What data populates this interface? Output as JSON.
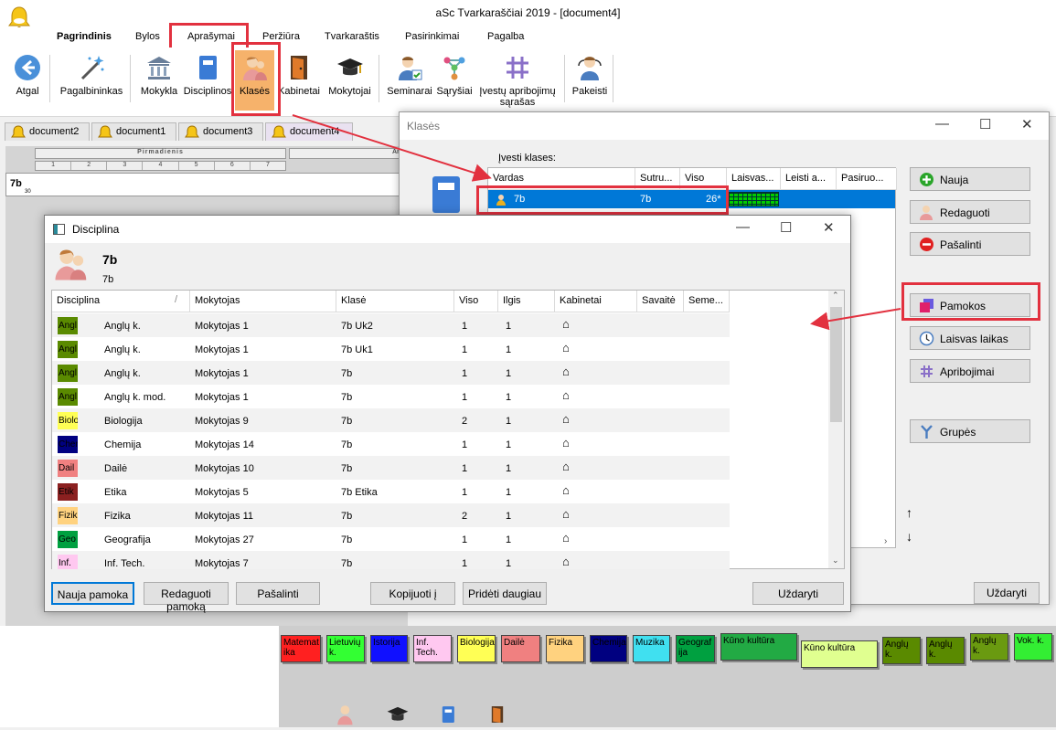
{
  "app": {
    "title": "aSc Tvarkaraščiai 2019  - [document4]"
  },
  "menu": [
    "Pagrindinis",
    "Bylos",
    "Aprašymai",
    "Peržiūra",
    "Tvarkaraštis",
    "Pasirinkimai",
    "Pagalba"
  ],
  "ribbon": {
    "atgal": "Atgal",
    "pagalbininkas": "Pagalbininkas",
    "mokykla": "Mokykla",
    "disciplinos": "Disciplinos",
    "klases": "Klasės",
    "kabinetai": "Kabinetai",
    "mokytojai": "Mokytojai",
    "seminarai": "Seminarai",
    "sarysiai": "Sąryšiai",
    "apribojimai1": "Įvestų apribojimų",
    "apribojimai2": "sąrašas",
    "pakeisti": "Pakeisti"
  },
  "doctabs": [
    "document2",
    "document1",
    "document3",
    "document4"
  ],
  "timetable": {
    "day": "Pirmadienis",
    "day2": "Ar",
    "periods": [
      "1",
      "2",
      "3",
      "4",
      "5",
      "6",
      "7"
    ],
    "row_label": "7b",
    "row_sub": "30"
  },
  "klases": {
    "title": "Klasės",
    "prompt": "Įvesti klases:",
    "columns": [
      "Vardas",
      "Sutru...",
      "Viso",
      "Laisvas...",
      "Leisti a...",
      "Pasiruo..."
    ],
    "row": {
      "name": "7b",
      "short": "7b",
      "total": "26*"
    },
    "buttons": {
      "nauja": "Nauja",
      "redaguoti": "Redaguoti",
      "pasalinti": "Pašalinti",
      "pamokos": "Pamokos",
      "laisvas": "Laisvas laikas",
      "apribojimai": "Apribojimai",
      "grupes": "Grupės",
      "uzdaryti": "Uždaryti"
    }
  },
  "disc": {
    "title": "Disciplina",
    "class_name": "7b",
    "class_short": "7b",
    "columns": [
      "Disciplina",
      "Mokytojas",
      "Klasė",
      "Viso",
      "Ilgis",
      "Kabinetai",
      "Savaitė",
      "Seme..."
    ],
    "rows": [
      {
        "sw": "Angl",
        "swc": "#5a8a00",
        "swt": "#000",
        "disc": "Anglų k.",
        "teacher": "Mokytojas 1",
        "klase": "7b Uk2",
        "viso": "1",
        "ilgis": "1"
      },
      {
        "sw": "Angl",
        "swc": "#5a8a00",
        "swt": "#000",
        "disc": "Anglų k.",
        "teacher": "Mokytojas 1",
        "klase": "7b Uk1",
        "viso": "1",
        "ilgis": "1"
      },
      {
        "sw": "Angl",
        "swc": "#5a8a00",
        "swt": "#000",
        "disc": "Anglų k.",
        "teacher": "Mokytojas 1",
        "klase": "7b",
        "viso": "1",
        "ilgis": "1"
      },
      {
        "sw": "Angl",
        "swc": "#5a8a00",
        "swt": "#000",
        "disc": "Anglų k. mod.",
        "teacher": "Mokytojas 1",
        "klase": "7b",
        "viso": "1",
        "ilgis": "1"
      },
      {
        "sw": "Biolo",
        "swc": "#ffff55",
        "swt": "#000",
        "disc": "Biologija",
        "teacher": "Mokytojas 9",
        "klase": "7b",
        "viso": "2",
        "ilgis": "1"
      },
      {
        "sw": "Chem",
        "swc": "#000080",
        "swt": "#000",
        "disc": "Chemija",
        "teacher": "Mokytojas 14",
        "klase": "7b",
        "viso": "1",
        "ilgis": "1"
      },
      {
        "sw": "Dail",
        "swc": "#f08080",
        "swt": "#000",
        "disc": "Dailė",
        "teacher": "Mokytojas 10",
        "klase": "7b",
        "viso": "1",
        "ilgis": "1"
      },
      {
        "sw": "Etik",
        "swc": "#8b2020",
        "swt": "#000",
        "disc": "Etika",
        "teacher": "Mokytojas 5",
        "klase": "7b Etika",
        "viso": "1",
        "ilgis": "1"
      },
      {
        "sw": "Fizik",
        "swc": "#ffd27f",
        "swt": "#000",
        "disc": "Fizika",
        "teacher": "Mokytojas 11",
        "klase": "7b",
        "viso": "2",
        "ilgis": "1"
      },
      {
        "sw": "Geo",
        "swc": "#00a040",
        "swt": "#000",
        "disc": "Geografija",
        "teacher": "Mokytojas 27",
        "klase": "7b",
        "viso": "1",
        "ilgis": "1"
      },
      {
        "sw": "Inf.",
        "swc": "#ffc8f0",
        "swt": "#000",
        "disc": "Inf. Tech.",
        "teacher": "Mokytojas 7",
        "klase": "7b",
        "viso": "1",
        "ilgis": "1"
      }
    ],
    "buttons": {
      "nauja": "Nauja pamoka",
      "redaguoti": "Redaguoti pamoką",
      "pasalinti": "Pašalinti",
      "kopijuoti": "Kopijuoti į",
      "prideti": "Pridėti daugiau",
      "uzdaryti": "Uždaryti"
    }
  },
  "palette": [
    {
      "text": "Matemat ika",
      "bg": "#ff2020",
      "fg": "#000"
    },
    {
      "text": "Lietuvių k.",
      "bg": "#33ff33",
      "fg": "#000"
    },
    {
      "text": "Istorija",
      "bg": "#1010ff",
      "fg": "#000"
    },
    {
      "text": "Inf. Tech.",
      "bg": "#ffc8f0",
      "fg": "#000"
    },
    {
      "text": "Biologija",
      "bg": "#ffff55",
      "fg": "#000"
    },
    {
      "text": "Dailė",
      "bg": "#f08080",
      "fg": "#000"
    },
    {
      "text": "Fizika",
      "bg": "#ffd27f",
      "fg": "#000"
    },
    {
      "text": "Chemija",
      "bg": "#000080",
      "fg": "#000"
    },
    {
      "text": "Muzika",
      "bg": "#40e0f0",
      "fg": "#000"
    },
    {
      "text": "Geograf ija",
      "bg": "#00a040",
      "fg": "#000"
    },
    {
      "text": "Kūno kultūra",
      "bg": "#22aa44",
      "fg": "#000"
    },
    {
      "text": "Kūno kultūra",
      "bg": "#e0ff90",
      "fg": "#000"
    },
    {
      "text": "Anglų k.",
      "bg": "#5a8a00",
      "fg": "#000"
    },
    {
      "text": "Anglų k.",
      "bg": "#5a8a00",
      "fg": "#000"
    },
    {
      "text": "Anglų k.",
      "bg": "#6a9a10",
      "fg": "#000"
    },
    {
      "text": "Vok. k.",
      "bg": "#33ee33",
      "fg": "#000"
    }
  ],
  "colors": {
    "highlight": "#e2313f",
    "selection": "#0078d7"
  }
}
